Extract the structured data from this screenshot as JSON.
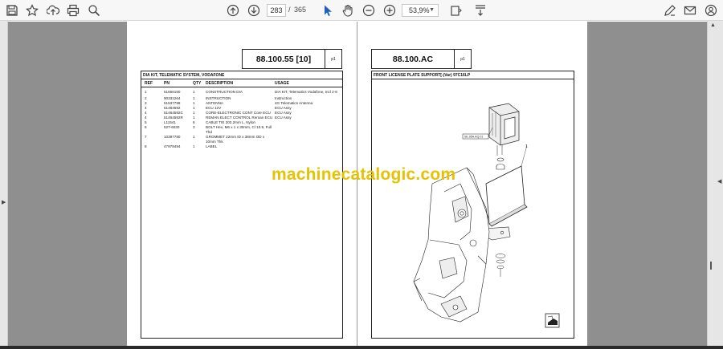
{
  "toolbar": {
    "icons": [
      "save-icon",
      "bookmark-star-icon",
      "upload-icon",
      "print-icon",
      "zoom-search-icon",
      "page-up-icon",
      "page-down-icon",
      "select-cursor-icon",
      "hand-icon",
      "zoom-out-icon",
      "zoom-in-icon",
      "fit-page-icon",
      "annotate-icon",
      "sign-icon",
      "email-icon",
      "account-icon"
    ],
    "page_current": "283",
    "page_separator": "/",
    "page_total": "365",
    "zoom": "53,9%"
  },
  "left_page": {
    "code": "88.100.55 [10]",
    "sub": "p1",
    "caption": "DIA KIT, TELEMATIC SYSTEM, VODAFONE",
    "headers": {
      "ref": "REF",
      "pn": "PN",
      "qty": "QTY",
      "desc": "DESCRIPTION",
      "usage": "USAGE"
    },
    "rows": [
      {
        "ref": "1",
        "pn": "51666160",
        "qty": "1",
        "desc": "CONSTRUCTION DIA",
        "usage": "DIA KIT, Telematics Vodafone, Incl 2-8"
      },
      {
        "ref": "2",
        "pn": "90331264",
        "qty": "1",
        "desc": "INSTRUCTION",
        "usage": "Instruction"
      },
      {
        "ref": "3",
        "pn": "51537798",
        "qty": "1",
        "desc": "ANTENNA",
        "usage": "4G Telematics Antenna"
      },
      {
        "ref": "4",
        "pn": "51464592",
        "qty": "1",
        "desc": "ECU 12V",
        "usage": "ECU Assy"
      },
      {
        "ref": "4",
        "pn": "51464592C",
        "qty": "1",
        "desc": "CORE-ELECTRONIC CONT Core ECU",
        "usage": "ECU Assy"
      },
      {
        "ref": "4",
        "pn": "51464592R",
        "qty": "1",
        "desc": "REMAN ELECT CONTROL Reman ECU",
        "usage": "ECU Assy"
      },
      {
        "ref": "5",
        "pn": "L11541",
        "qty": "6",
        "desc": "CABLE TIE 203.2mm L. Nylon",
        "usage": ""
      },
      {
        "ref": "6",
        "pn": "527-6030",
        "qty": "3",
        "desc": "BOLT Hex, M6 x 1 x 30mm, Cl 10.9, Full Thd",
        "usage": ""
      },
      {
        "ref": "7",
        "pn": "10397780",
        "qty": "1",
        "desc": "GROMMET 22mm ID x 38mm OD x 10mm Thk",
        "usage": ""
      },
      {
        "ref": "8",
        "pn": "47978494",
        "qty": "1",
        "desc": "LABEL",
        "usage": ""
      }
    ]
  },
  "right_page": {
    "code": "88.100.AC",
    "sub": "p1",
    "caption": "FRONT LICENSE PLATE SUPPORT[-(Var) 97C16LP",
    "callout_part": "1",
    "callout_tag": "SE.95A.AQ.01"
  },
  "watermark": "machinecatalogic.com"
}
